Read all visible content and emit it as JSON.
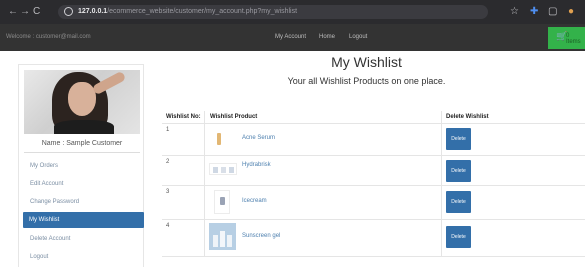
{
  "browser": {
    "nav_back": "←",
    "nav_forward": "→",
    "reload": "C",
    "url_host": "127.0.0.1",
    "url_path": "/ecommerce_website/customer/my_account.php?my_wishlist",
    "bookmark_icon": "star-icon",
    "extension_icon": "puzzle-icon",
    "profile_icon": "avatar-icon"
  },
  "topbar": {
    "welcome": "Welcome : customer@mail.com",
    "links": [
      "My Account",
      "Home",
      "Logout"
    ],
    "cart_label": "0 Items"
  },
  "sidebar": {
    "user_name": "Name : Sample Customer",
    "items": [
      {
        "label": "My Orders",
        "active": false
      },
      {
        "label": "Edit Account",
        "active": false
      },
      {
        "label": "Change Password",
        "active": false
      },
      {
        "label": "My Wishlist",
        "active": true
      },
      {
        "label": "Delete Account",
        "active": false
      },
      {
        "label": "Logout",
        "active": false
      }
    ]
  },
  "main": {
    "title": "My Wishlist",
    "subtitle": "Your all Wishlist Products on one place.",
    "columns": [
      "Wishlist No:",
      "Wishlist Product",
      "Delete Wishlist"
    ],
    "rows": [
      {
        "no": "1",
        "product": "Acne Serum",
        "delete": "Delete"
      },
      {
        "no": "2",
        "product": "Hydrabrisk",
        "delete": "Delete"
      },
      {
        "no": "3",
        "product": "Icecream",
        "delete": "Delete"
      },
      {
        "no": "4",
        "product": "Sunscreen gel",
        "delete": "Delete"
      }
    ]
  },
  "colors": {
    "primary": "#336fa9",
    "topbar": "#333333",
    "cart": "#33b24a",
    "link": "#4c7fae"
  }
}
